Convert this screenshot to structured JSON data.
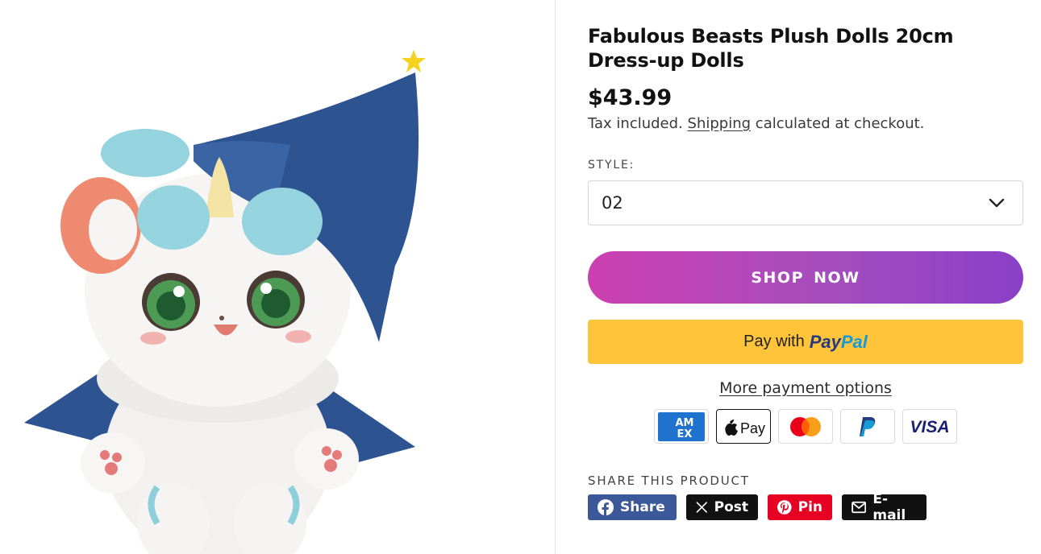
{
  "product": {
    "title": "Fabulous Beasts Plush Dolls 20cm Dress-up Dolls",
    "price": "$43.99",
    "tax_prefix": "Tax included.",
    "shipping_link": "Shipping",
    "tax_suffix": "calculated at checkout."
  },
  "style": {
    "label": "STYLE:",
    "selected": "02"
  },
  "buttons": {
    "shop_now": "SHOP NOW",
    "paypal_prefix": "Pay with",
    "paypal_pay": "Pay",
    "paypal_pal": "Pal",
    "more_payment": "More payment options"
  },
  "payment_icons": [
    "amex-icon",
    "apple-pay-icon",
    "mastercard-icon",
    "paypal-icon",
    "visa-icon"
  ],
  "payment_text": {
    "amex_top": "AM",
    "amex_bottom": "EX",
    "apple_pay": "Pay",
    "visa": "VISA"
  },
  "share": {
    "label": "SHARE THIS PRODUCT",
    "facebook": "Share",
    "x": "Post",
    "pinterest": "Pin",
    "email": "E-mail"
  },
  "colors": {
    "shop_gradient_start": "#cc3fb0",
    "shop_gradient_end": "#8b3fc7",
    "paypal_yellow": "#ffc439",
    "facebook": "#3b5998",
    "pinterest": "#e60023"
  }
}
